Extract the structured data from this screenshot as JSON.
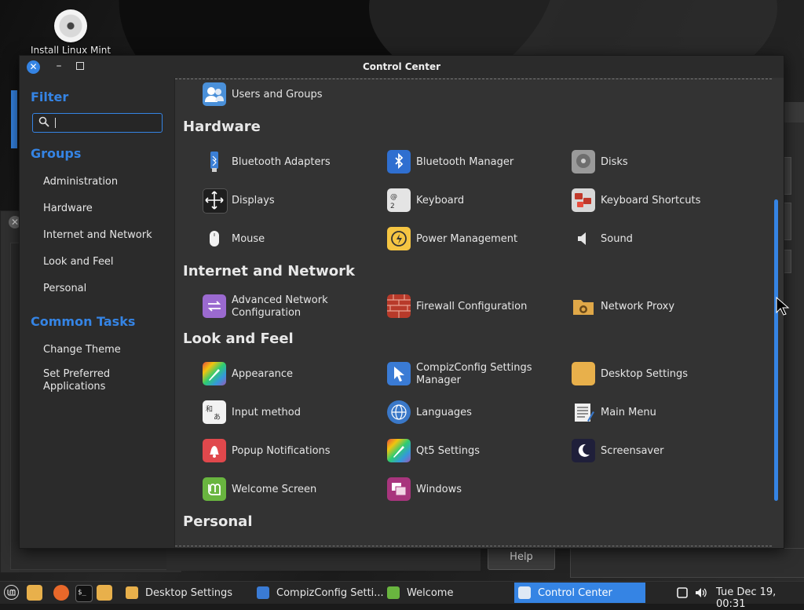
{
  "window": {
    "title": "Control Center"
  },
  "desktop": {
    "icon_label": "Install Linux Mint"
  },
  "background_window": {
    "help_label": "Help"
  },
  "sidebar": {
    "filter_label": "Filter",
    "search_value": "",
    "groups_label": "Groups",
    "groups": [
      "Administration",
      "Hardware",
      "Internet and Network",
      "Look and Feel",
      "Personal"
    ],
    "common_tasks_label": "Common Tasks",
    "tasks": [
      "Change Theme",
      "Set Preferred Applications"
    ]
  },
  "content": {
    "top_item": "Users and Groups",
    "sections": [
      {
        "title": "Hardware",
        "items": [
          "Bluetooth Adapters",
          "Bluetooth Manager",
          "Disks",
          "Displays",
          "Keyboard",
          "Keyboard Shortcuts",
          "Mouse",
          "Power Management",
          "Sound"
        ]
      },
      {
        "title": "Internet and Network",
        "items": [
          "Advanced Network Configuration",
          "Firewall Configuration",
          "Network Proxy"
        ]
      },
      {
        "title": "Look and Feel",
        "items": [
          "Appearance",
          "CompizConfig Settings Manager",
          "Desktop Settings",
          "Input method",
          "Languages",
          "Main Menu",
          "Popup Notifications",
          "Qt5 Settings",
          "Screensaver",
          "Welcome Screen",
          "Windows"
        ]
      },
      {
        "title": "Personal",
        "items": []
      }
    ]
  },
  "panel": {
    "task_buttons": [
      "Desktop Settings",
      "CompizConfig Setti...",
      "Welcome",
      "Control Center"
    ],
    "launchers": [
      "mint-menu-icon",
      "files-icon",
      "firefox-icon",
      "terminal-icon",
      "folder-icon"
    ],
    "clock": "Tue Dec 19, 00:31"
  },
  "colors": {
    "accent": "#3584e4",
    "window_bg": "#333333",
    "sidebar_bg": "#2b2b2b"
  }
}
